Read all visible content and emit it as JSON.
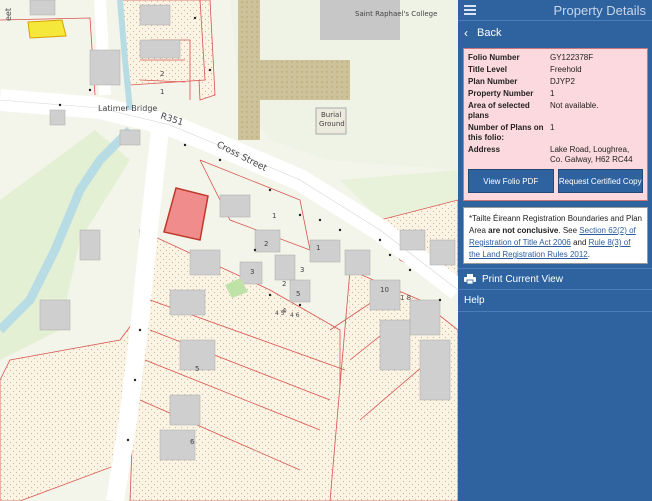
{
  "panel": {
    "title": "Property Details",
    "back_label": "Back",
    "details": [
      {
        "key": "Folio Number",
        "value": "GY122378F"
      },
      {
        "key": "Title Level",
        "value": "Freehold"
      },
      {
        "key": "Plan Number",
        "value": "DJYP2"
      },
      {
        "key": "Property Number",
        "value": "1"
      },
      {
        "key": "Area of selected plans",
        "value": "Not available."
      },
      {
        "key": "Number of Plans on this folio:",
        "value": "1"
      },
      {
        "key": "Address",
        "value": "Lake Road, Loughrea, Co. Galway, H62 RC44"
      }
    ],
    "view_pdf_label": "View Folio PDF",
    "request_label": "Request Certified Copy",
    "note": {
      "prefix": "*Tailte Éireann Registration Boundaries and Plan Area ",
      "bold": "are not conclusive",
      "mid": ". See ",
      "link1": "Section 62(2) of Registration of Title Act 2006",
      "and": " and ",
      "link2": "Rule 8(3) of the Land Registration Rules 2012",
      "end": "."
    },
    "print_label": "Print Current View",
    "help_label": "Help"
  },
  "map": {
    "labels": {
      "latimer": "Latimer Bridge",
      "r351": "R351",
      "cross": "Cross Street",
      "burial1": "Burial",
      "burial2": "Ground",
      "college": "Saint Raphael's College",
      "street_frag": "eet"
    },
    "house_numbers": [
      "1",
      "2",
      "1",
      "2",
      "3",
      "1",
      "3",
      "5",
      "2",
      "4",
      "10",
      "1 8",
      "5",
      "6",
      "4 5",
      "4 6"
    ]
  },
  "colors": {
    "panel": "#2f63a0",
    "selected_plot": "#f08c8c",
    "boundary": "#d9534f"
  }
}
